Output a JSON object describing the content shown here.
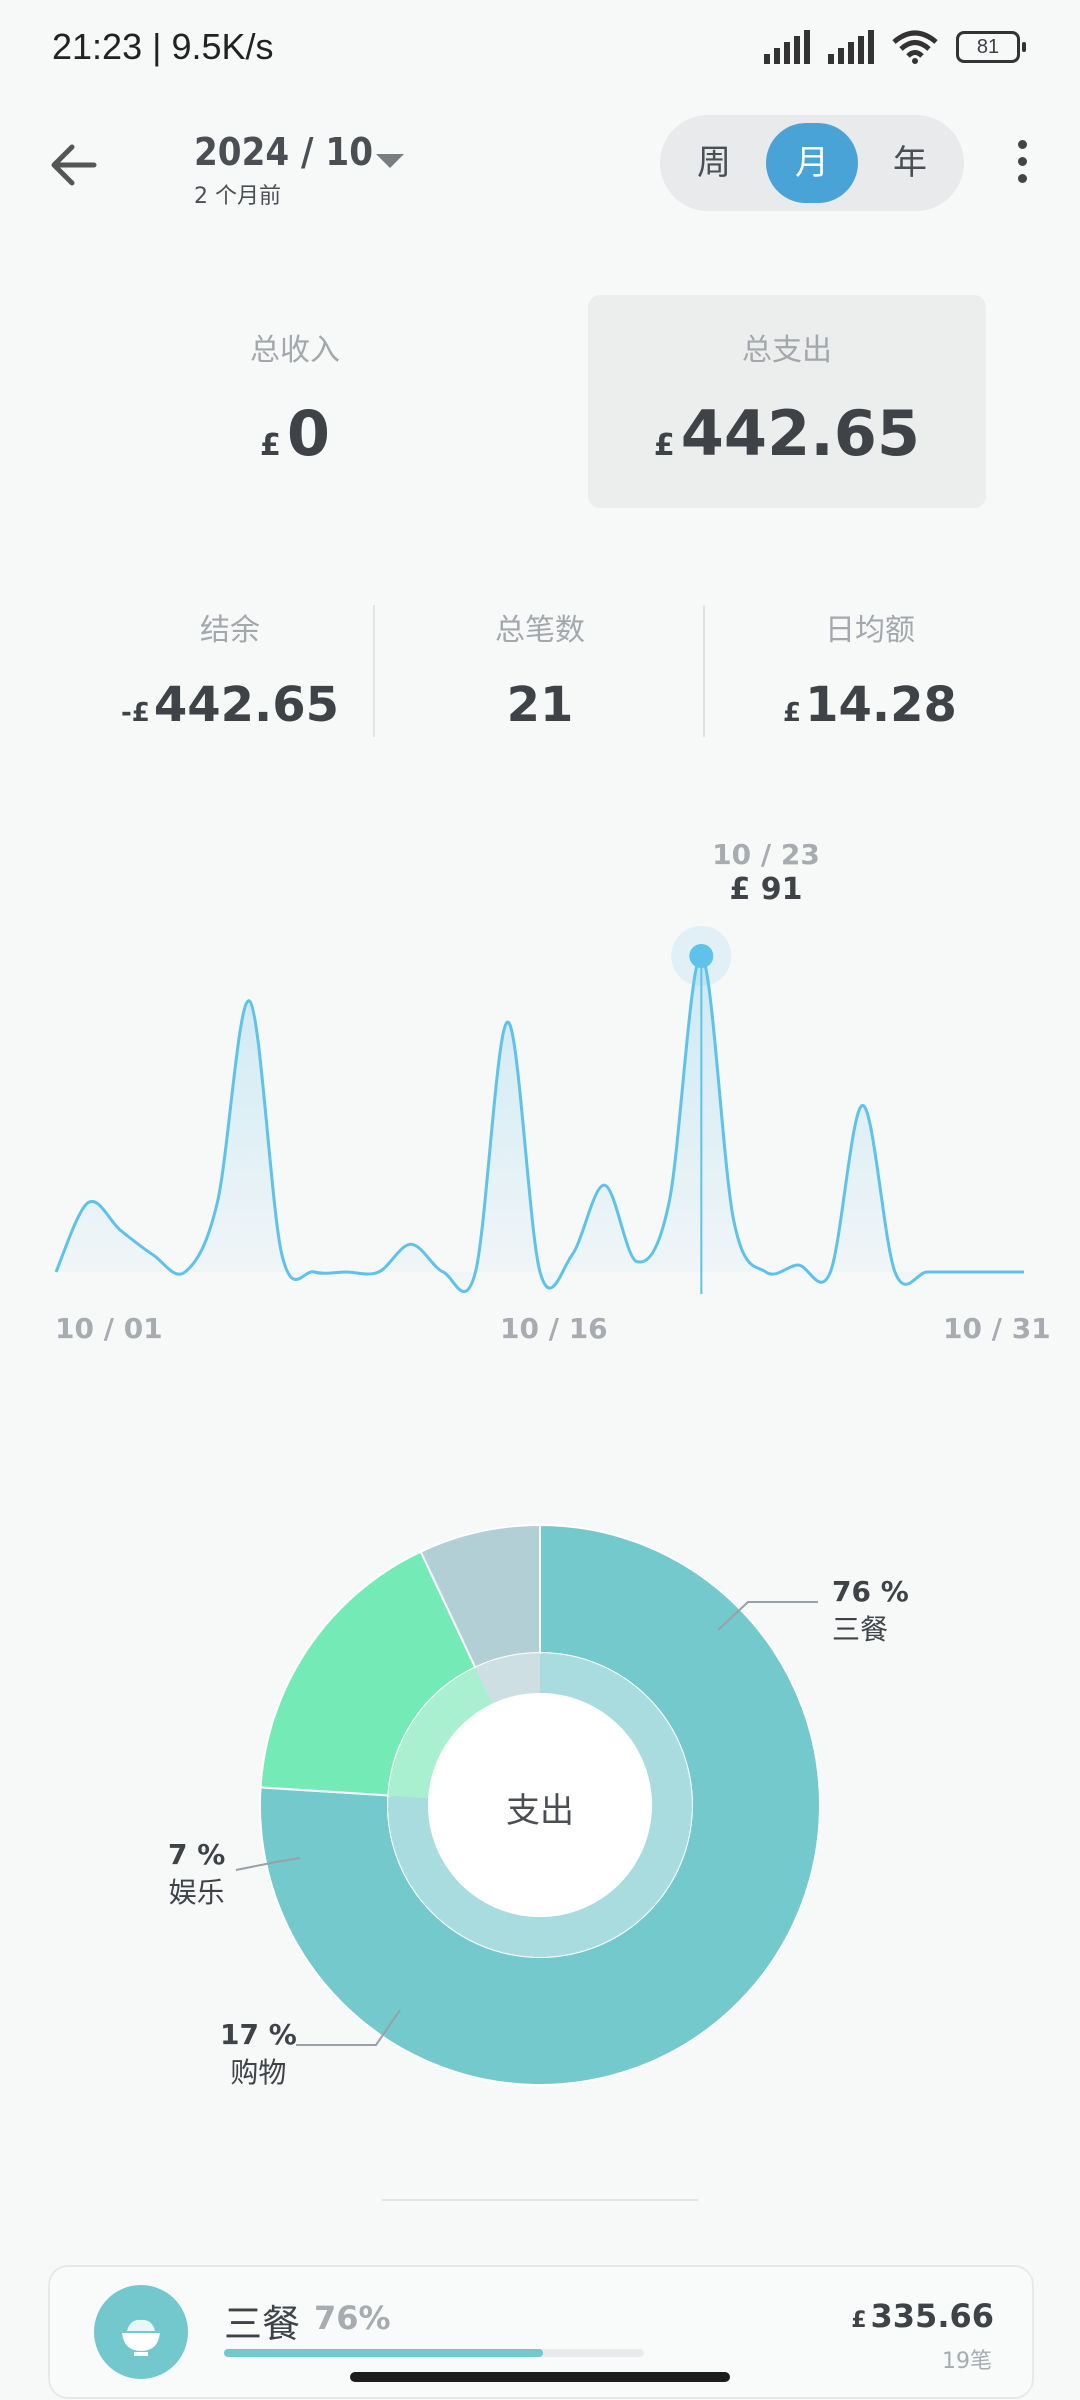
{
  "status_bar": {
    "time": "21:23",
    "speed": "| 9.5K/s",
    "battery": "81"
  },
  "header": {
    "month": "2024 / 10",
    "relative": "2 个月前",
    "segments": [
      "周",
      "月",
      "年"
    ],
    "selected_segment": "月"
  },
  "summary": {
    "income_label": "总收入",
    "income_currency": "£",
    "income_value": "0",
    "expense_label": "总支出",
    "expense_currency": "£",
    "expense_value": "442.65"
  },
  "stats": {
    "balance_label": "结余",
    "balance_prefix": "-£",
    "balance_value": "442.65",
    "count_label": "总笔数",
    "count_value": "21",
    "daily_label": "日均额",
    "daily_currency": "£",
    "daily_value": "14.28"
  },
  "chart_data": {
    "type": "area",
    "x": [
      "10/01",
      "10/02",
      "10/03",
      "10/04",
      "10/05",
      "10/06",
      "10/07",
      "10/08",
      "10/09",
      "10/10",
      "10/11",
      "10/12",
      "10/13",
      "10/14",
      "10/15",
      "10/16",
      "10/17",
      "10/18",
      "10/19",
      "10/20",
      "10/21",
      "10/22",
      "10/23",
      "10/24",
      "10/25",
      "10/26",
      "10/27",
      "10/28",
      "10/29",
      "10/30",
      "10/31"
    ],
    "values": [
      0,
      20,
      12,
      5,
      0,
      20,
      78,
      5,
      0,
      0,
      0,
      8,
      0,
      0,
      72,
      0,
      5,
      25,
      3,
      20,
      91,
      15,
      0,
      2,
      0,
      48,
      0,
      0,
      0,
      0,
      0
    ],
    "x_tick_labels": [
      "10 / 01",
      "10 / 16",
      "10 / 31"
    ],
    "highlight": {
      "date": "10 / 23",
      "value_label": "£ 91",
      "index": 20
    },
    "color": "#5ec2ea"
  },
  "pie": {
    "center_label": "支出",
    "slices": [
      {
        "name": "三餐",
        "pct": 76,
        "pct_label": "76 %",
        "color": "#74c9cd"
      },
      {
        "name": "购物",
        "pct": 17,
        "pct_label": "17 %",
        "color": "#74ebb6"
      },
      {
        "name": "娱乐",
        "pct": 7,
        "pct_label": "7 %",
        "color": "#b2cfd6"
      }
    ]
  },
  "category": {
    "name": "三餐",
    "pct_label": "76%",
    "pct": 76,
    "currency": "£",
    "amount": "335.66",
    "count": "19笔",
    "icon": "rice-bowl-icon"
  }
}
